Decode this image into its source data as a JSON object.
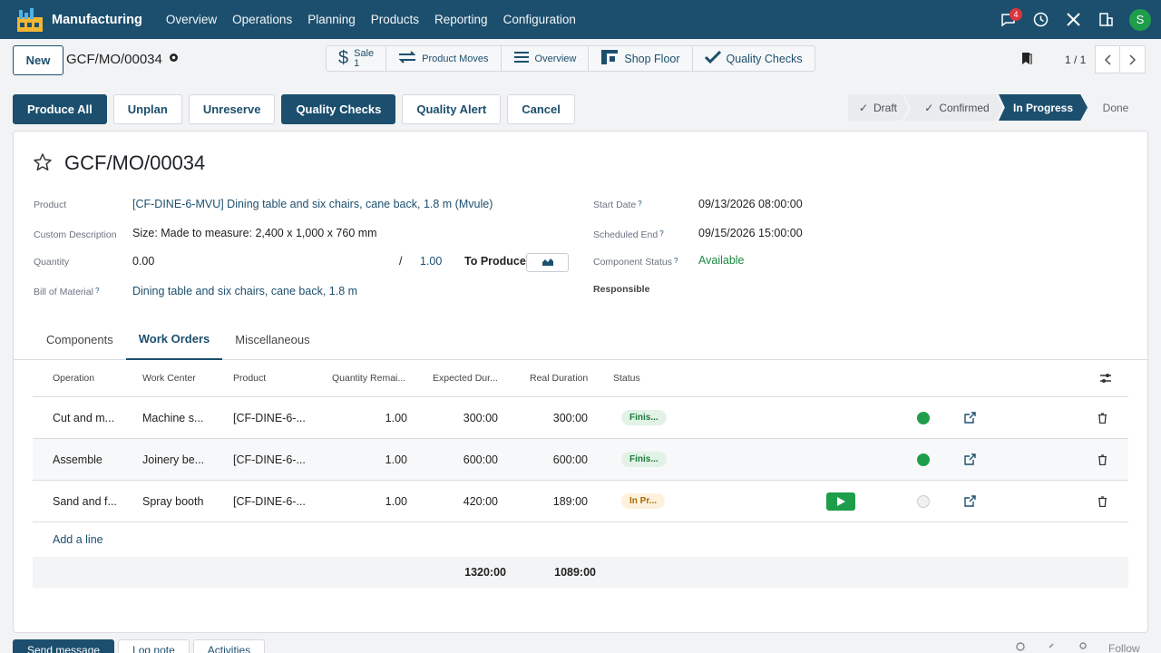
{
  "navbar": {
    "app_name": "Manufacturing",
    "menu": [
      "Overview",
      "Operations",
      "Planning",
      "Products",
      "Reporting",
      "Configuration"
    ],
    "messages_badge": "4",
    "avatar_letter": "S"
  },
  "control": {
    "new_label": "New",
    "breadcrumb": "GCF/MO/00034",
    "smart_buttons": {
      "sale_label": "Sale",
      "sale_count": "1",
      "product_moves": "Product Moves",
      "overview": "Overview",
      "shop_floor": "Shop Floor",
      "quality_checks": "Quality Checks"
    },
    "pager": "1 / 1"
  },
  "actions": [
    "Produce All",
    "Unplan",
    "Unreserve",
    "Quality Checks",
    "Quality Alert",
    "Cancel"
  ],
  "statusbar": {
    "stages": [
      "Draft",
      "Confirmed",
      "In Progress",
      "Done"
    ],
    "current": "In Progress",
    "check_mark": "✓"
  },
  "form": {
    "title": "GCF/MO/00034",
    "product_label": "Product",
    "product_value": "[CF-DINE-6-MVU] Dining table and six chairs, cane back, 1.8 m (Mvule)",
    "custom_desc_label": "Custom Description",
    "custom_desc_value": "Size: Made to measure: 2,400 x 1,000 x 760 mm",
    "quantity_label": "Quantity",
    "quantity_value": "0.00",
    "quantity_sep": "/",
    "quantity_target": "1.00",
    "to_produce": "To Produce",
    "bom_label": "Bill of Material",
    "bom_value": "Dining table and six chairs, cane back, 1.8 m",
    "start_label": "Start Date",
    "start_value": "09/13/2026 08:00:00",
    "sched_end_label": "Scheduled End",
    "sched_end_value": "09/15/2026 15:00:00",
    "component_status_label": "Component Status",
    "component_status_value": "Available",
    "responsible_label": "Responsible",
    "help_mark": "?"
  },
  "tabs": [
    "Components",
    "Work Orders",
    "Miscellaneous"
  ],
  "active_tab": "Work Orders",
  "work_orders": {
    "columns": [
      "Operation",
      "Work Center",
      "Product",
      "Quantity Remai...",
      "Expected Dur...",
      "Real Duration",
      "Status"
    ],
    "rows": [
      {
        "operation": "Cut and m...",
        "work_center": "Machine s...",
        "product": "[CF-DINE-6-...",
        "qty": "1.00",
        "expected": "300:00",
        "real": "300:00",
        "status": "Finis...",
        "status_kind": "finished"
      },
      {
        "operation": "Assemble",
        "work_center": "Joinery be...",
        "product": "[CF-DINE-6-...",
        "qty": "1.00",
        "expected": "600:00",
        "real": "600:00",
        "status": "Finis...",
        "status_kind": "finished"
      },
      {
        "operation": "Sand and f...",
        "work_center": "Spray booth",
        "product": "[CF-DINE-6-...",
        "qty": "1.00",
        "expected": "420:00",
        "real": "189:00",
        "status": "In Pr...",
        "status_kind": "in_progress"
      }
    ],
    "add_line": "Add a line",
    "total_expected": "1320:00",
    "total_real": "1089:00"
  },
  "chatter": {
    "send_message": "Send message",
    "log_note": "Log note",
    "activities": "Activities",
    "follow": "Follow"
  },
  "colors": {
    "brand": "#1c4f6e",
    "success": "#1e9e4a",
    "danger": "#d9363e"
  }
}
